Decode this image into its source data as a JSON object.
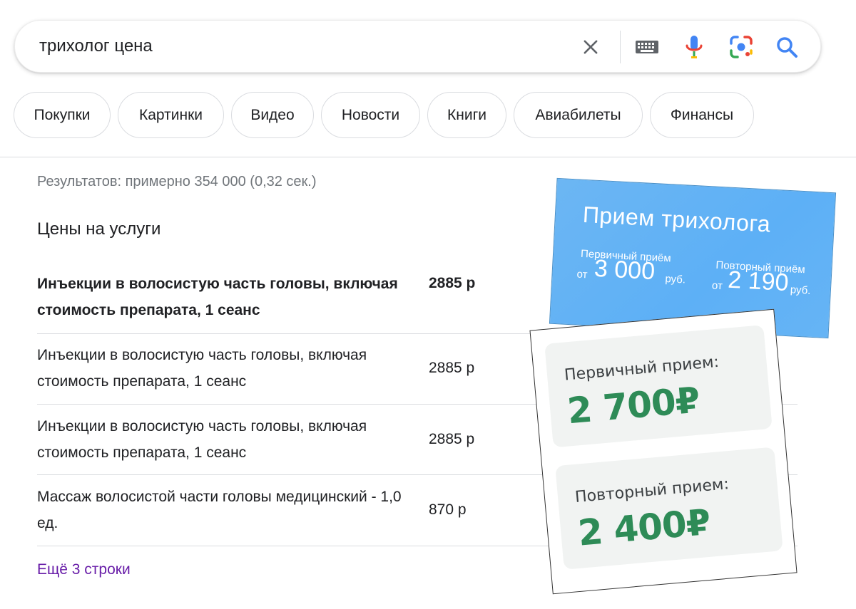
{
  "search": {
    "query": "трихолог цена"
  },
  "chips": [
    "Покупки",
    "Картинки",
    "Видео",
    "Новости",
    "Книги",
    "Авиабилеты",
    "Финансы"
  ],
  "results": {
    "stats": "Результатов: примерно 354 000 (0,32 сек.)",
    "section_title": "Цены на услуги",
    "rows": [
      {
        "name": "Инъекции в волосистую часть головы, включая стоимость препарата, 1 сеанс",
        "price": "2885 р"
      },
      {
        "name": "Инъекции в волосистую часть головы, включая стоимость препарата, 1 сеанс",
        "price": "2885 р"
      },
      {
        "name": "Инъекции в волосистую часть головы, включая стоимость препарата, 1 сеанс",
        "price": "2885 р"
      },
      {
        "name": "Массаж волосистой части головы медицинский - 1,0 ед.",
        "price": "870 р"
      }
    ],
    "more_link": "Ещё 3 строки"
  },
  "blue_card": {
    "title": "Прием трихолога",
    "first_label": "Первичный приём",
    "first_from": "от",
    "first_value": "3 000",
    "first_unit": "руб.",
    "second_label": "Повторный приём",
    "second_from": "от",
    "second_value": "2 190",
    "second_unit": "руб."
  },
  "white_card": {
    "first_label": "Первичный прием:",
    "first_value": "2 700₽",
    "second_label": "Повторный прием:",
    "second_value": "2 400₽"
  },
  "colors": {
    "link_visited": "#681da8",
    "price_green": "#2e8b57",
    "card_blue": "#5db0f6"
  }
}
